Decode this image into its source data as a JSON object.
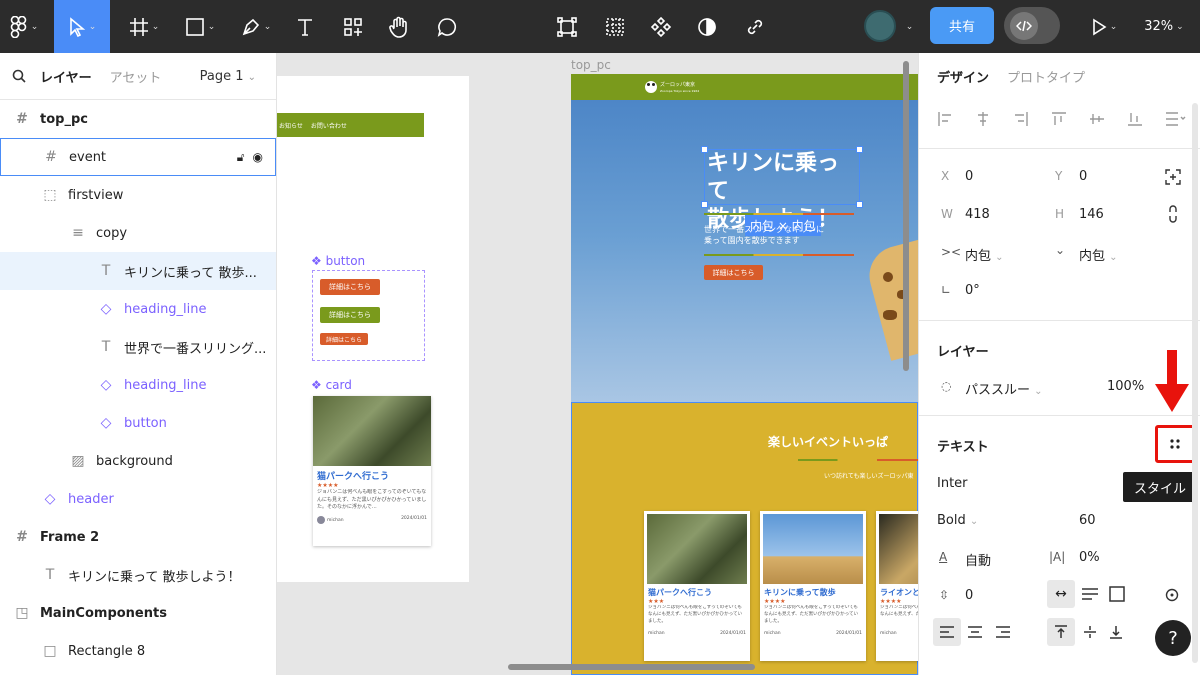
{
  "toolbar": {
    "share": "共有",
    "zoom": "32%"
  },
  "layers_panel": {
    "tab_layers": "レイヤー",
    "tab_assets": "アセット",
    "page": "Page 1",
    "items": [
      {
        "label": "top_pc",
        "icon": "frame-icon",
        "comp": false,
        "bold": true,
        "indent": 0
      },
      {
        "label": "event",
        "icon": "frame-icon",
        "comp": false,
        "bold": false,
        "indent": 1
      },
      {
        "label": "firstview",
        "icon": "dashed-frame-icon",
        "comp": false,
        "bold": false,
        "indent": 1
      },
      {
        "label": "copy",
        "icon": "auto-layout-icon",
        "comp": false,
        "bold": false,
        "indent": 2
      },
      {
        "label": "キリンに乗って 散歩...",
        "icon": "text-icon",
        "comp": false,
        "bold": false,
        "indent": 3
      },
      {
        "label": "heading_line",
        "icon": "instance-icon",
        "comp": true,
        "bold": false,
        "indent": 3
      },
      {
        "label": "世界で一番スリリング...",
        "icon": "text-icon",
        "comp": false,
        "bold": false,
        "indent": 3
      },
      {
        "label": "heading_line",
        "icon": "instance-icon",
        "comp": true,
        "bold": false,
        "indent": 3
      },
      {
        "label": "button",
        "icon": "instance-icon",
        "comp": true,
        "bold": false,
        "indent": 3
      },
      {
        "label": "background",
        "icon": "image-icon",
        "comp": false,
        "bold": false,
        "indent": 2
      },
      {
        "label": "header",
        "icon": "instance-icon",
        "comp": true,
        "bold": false,
        "indent": 1
      },
      {
        "label": "Frame 2",
        "icon": "frame-icon",
        "comp": false,
        "bold": true,
        "indent": 0
      },
      {
        "label": "キリンに乗って 散歩しよう！",
        "icon": "text-icon",
        "comp": false,
        "bold": false,
        "indent": 1
      },
      {
        "label": "MainComponents",
        "icon": "section-icon",
        "comp": false,
        "bold": true,
        "indent": 0
      },
      {
        "label": "Rectangle 8",
        "icon": "rect-icon",
        "comp": false,
        "bold": false,
        "indent": 1
      }
    ]
  },
  "canvas": {
    "frame_label": "top_pc",
    "left_nav": [
      "お知らせ",
      "お問い合わせ"
    ],
    "button_group_label": "❖ button",
    "btn1": "詳細はこちら",
    "btn2": "詳細はこちら",
    "btn3": "詳細はこちら",
    "card_group_label": "❖ card",
    "card_title": "猫パークへ行こう",
    "card_stars": "★★★★",
    "card_text": "ジョバンニは何べんも眼をこすってのぞいてもなんにも見えず、ただ黒いぴかぴかひかっていました。そのなかに浮かんで…",
    "card_user": "michan",
    "card_date": "2024/01/01",
    "site_logo": "ズーロッパ東京",
    "site_logo_sub": "Zooropa Tokyo since 1964",
    "hero_title_1": "キリンに乗って",
    "hero_title_2": "散歩しよう！",
    "sizing_badge": "内包 × 内包",
    "hero_sub_1": "世界で一番スリリングなキリンに",
    "hero_sub_2": "乗って園内を散歩できます",
    "hero_btn": "詳細はこちら",
    "event_title": "楽しいイベントいっぱ",
    "event_sub": "いつ訪れても楽しいズーロッパ東",
    "cards": [
      {
        "title": "猫パークへ行こう",
        "stars": "★★★",
        "text": "ジョバンニは何べんも眼をこすってのぞいてもなんにも見えず、ただ黒いぴかぴかひかっていました。",
        "user": "michan",
        "date": "2024/01/01"
      },
      {
        "title": "キリンに乗って散歩",
        "stars": "★★★★",
        "text": "ジョバンニは何べんも眼をこすってのぞいてもなんにも見えず、ただ黒いぴかぴかひかっていました。",
        "user": "michan",
        "date": "2024/01/01"
      },
      {
        "title": "ライオンと",
        "stars": "★★★★",
        "text": "ジョバンニは何べんも眼をこすってのぞいてもなんにも見えず、ただ黒いぴ",
        "user": "michan",
        "date": ""
      }
    ]
  },
  "design_panel": {
    "tab_design": "デザイン",
    "tab_prototype": "プロトタイプ",
    "x_label": "X",
    "x": "0",
    "y_label": "Y",
    "y": "0",
    "w_label": "W",
    "w": "418",
    "h_label": "H",
    "h": "146",
    "hsize": "内包",
    "vsize": "内包",
    "rotation": "0°",
    "layer_title": "レイヤー",
    "blend": "パススルー",
    "opacity": "100%",
    "text_title": "テキスト",
    "tooltip": "スタイル",
    "font": "Inter",
    "weight": "Bold",
    "size": "60",
    "line_height": "自動",
    "letter_spacing": "0%",
    "para_spacing": "0",
    "help": "?"
  },
  "colors": {
    "accent": "#4a8cf7",
    "component": "#7b61ff",
    "red_arrow": "#e8130c",
    "header_green": "#7a9a1c",
    "mustard": "#d9b22d"
  }
}
